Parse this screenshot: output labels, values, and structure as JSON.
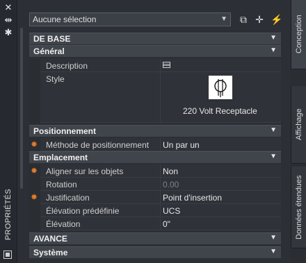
{
  "palette": {
    "title": "PROPRIÉTÉS",
    "strip_buttons": [
      "close-icon",
      "autohide-icon",
      "settings-icon"
    ]
  },
  "selection": {
    "value": "Aucune sélection"
  },
  "tools": [
    "add-selection-icon",
    "pick-object-icon",
    "quick-select-icon"
  ],
  "sections": {
    "de_base": "DE BASE",
    "general": "Général",
    "positionnement": "Positionnement",
    "emplacement": "Emplacement",
    "avance": "AVANCE",
    "systeme": "Système"
  },
  "general": {
    "description_label": "Description",
    "style_label": "Style",
    "style_caption": "220 Volt Receptacle"
  },
  "positionnement": {
    "methode_label": "Méthode de positionnement",
    "methode_value": "Un par un"
  },
  "emplacement": {
    "rows": [
      {
        "label": "Aligner sur les objets",
        "value": "Non"
      },
      {
        "label": "Rotation",
        "value": "0.00"
      },
      {
        "label": "Justification",
        "value": "Point d'insertion"
      },
      {
        "label": "Élévation prédéfinie",
        "value": "UCS"
      },
      {
        "label": "Élévation",
        "value": "0\""
      }
    ]
  },
  "tabs": {
    "conception": "Conception",
    "affichage": "Affichage",
    "donnees": "Données étendues"
  },
  "colors": {
    "accent_star": "#e07b2a",
    "background": "#2c2f35"
  }
}
